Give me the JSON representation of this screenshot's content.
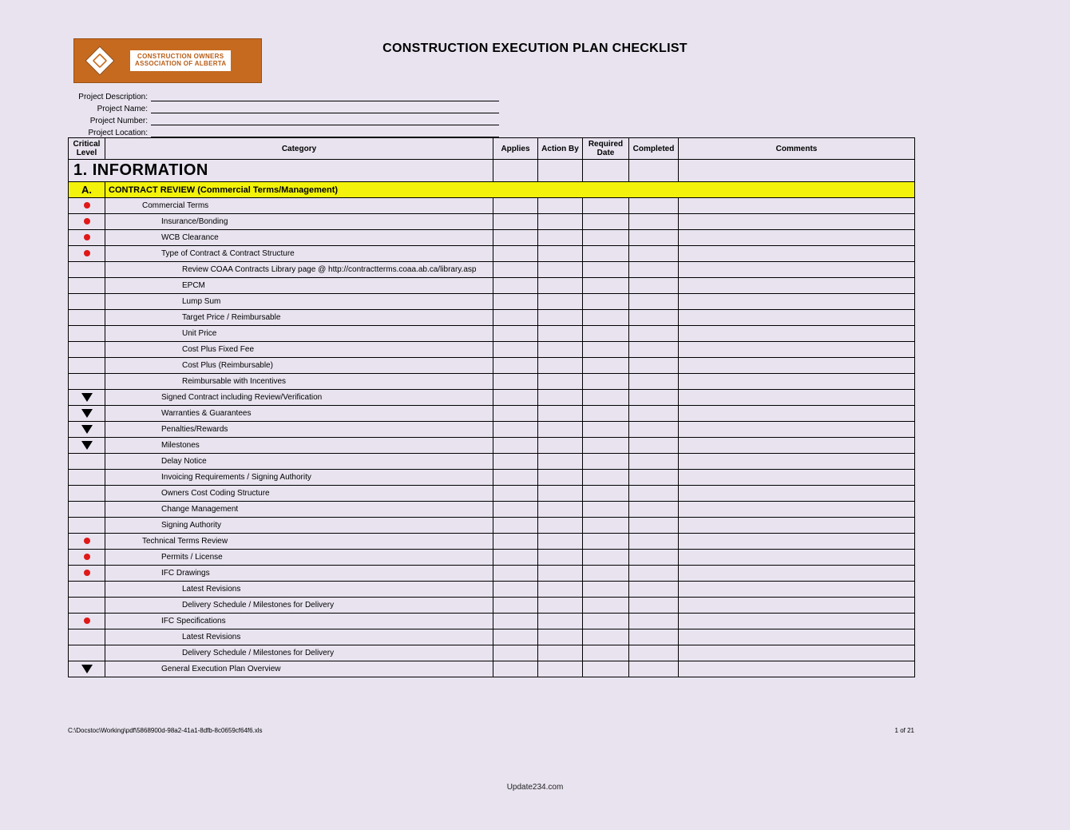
{
  "title": "CONSTRUCTION EXECUTION PLAN CHECKLIST",
  "logo": {
    "line1": "CONSTRUCTION OWNERS",
    "line2": "ASSOCIATION OF ALBERTA"
  },
  "meta": {
    "labels": [
      "Project Description:",
      "Project Name:",
      "Project Number:",
      "Project Location:"
    ]
  },
  "headers": {
    "critical": "Critical Level",
    "category": "Category",
    "applies": "Applies",
    "action_by": "Action By",
    "required_date": "Required Date",
    "completed": "Completed",
    "comments": "Comments"
  },
  "section": {
    "number": "1.",
    "title": "INFORMATION"
  },
  "subhead": {
    "letter": "A.",
    "title": "CONTRACT REVIEW (Commercial Terms/Management)"
  },
  "rows": [
    {
      "crit": "dot",
      "indent": 1,
      "text": "Commercial Terms"
    },
    {
      "crit": "dot",
      "indent": 2,
      "text": "Insurance/Bonding"
    },
    {
      "crit": "dot",
      "indent": 2,
      "text": "WCB Clearance"
    },
    {
      "crit": "dot",
      "indent": 2,
      "text": "Type of Contract & Contract Structure"
    },
    {
      "crit": "",
      "indent": 3,
      "text": "Review COAA Contracts Library page @ http://contractterms.coaa.ab.ca/library.asp"
    },
    {
      "crit": "",
      "indent": 3,
      "text": "EPCM"
    },
    {
      "crit": "",
      "indent": 3,
      "text": "Lump Sum"
    },
    {
      "crit": "",
      "indent": 3,
      "text": "Target Price / Reimbursable"
    },
    {
      "crit": "",
      "indent": 3,
      "text": "Unit Price"
    },
    {
      "crit": "",
      "indent": 3,
      "text": "Cost Plus Fixed Fee"
    },
    {
      "crit": "",
      "indent": 3,
      "text": "Cost Plus (Reimbursable)"
    },
    {
      "crit": "",
      "indent": 3,
      "text": "Reimbursable with Incentives"
    },
    {
      "crit": "tri",
      "indent": 2,
      "text": "Signed Contract including Review/Verification"
    },
    {
      "crit": "tri",
      "indent": 2,
      "text": "Warranties & Guarantees"
    },
    {
      "crit": "tri",
      "indent": 2,
      "text": "Penalties/Rewards"
    },
    {
      "crit": "tri",
      "indent": 2,
      "text": "Milestones"
    },
    {
      "crit": "",
      "indent": 2,
      "text": "Delay Notice"
    },
    {
      "crit": "",
      "indent": 2,
      "text": "Invoicing Requirements / Signing Authority"
    },
    {
      "crit": "",
      "indent": 2,
      "text": "Owners Cost Coding Structure"
    },
    {
      "crit": "",
      "indent": 2,
      "text": "Change Management"
    },
    {
      "crit": "",
      "indent": 2,
      "text": "Signing Authority"
    },
    {
      "crit": "dot",
      "indent": 1,
      "text": "Technical Terms Review"
    },
    {
      "crit": "dot",
      "indent": 2,
      "text": "Permits / License"
    },
    {
      "crit": "dot",
      "indent": 2,
      "text": "IFC Drawings"
    },
    {
      "crit": "",
      "indent": 3,
      "text": "Latest Revisions"
    },
    {
      "crit": "",
      "indent": 3,
      "text": "Delivery Schedule / Milestones for Delivery"
    },
    {
      "crit": "dot",
      "indent": 2,
      "text": "IFC Specifications"
    },
    {
      "crit": "",
      "indent": 3,
      "text": "Latest Revisions"
    },
    {
      "crit": "",
      "indent": 3,
      "text": "Delivery Schedule / Milestones for Delivery"
    },
    {
      "crit": "tri",
      "indent": 2,
      "text": "General Execution Plan Overview"
    }
  ],
  "footer": {
    "path": "C:\\Docstoc\\Working\\pdf\\5868900d-98a2-41a1-8dfb-8c0659cf64f6.xls",
    "page": "1 of 21",
    "credit": "Update234.com"
  }
}
